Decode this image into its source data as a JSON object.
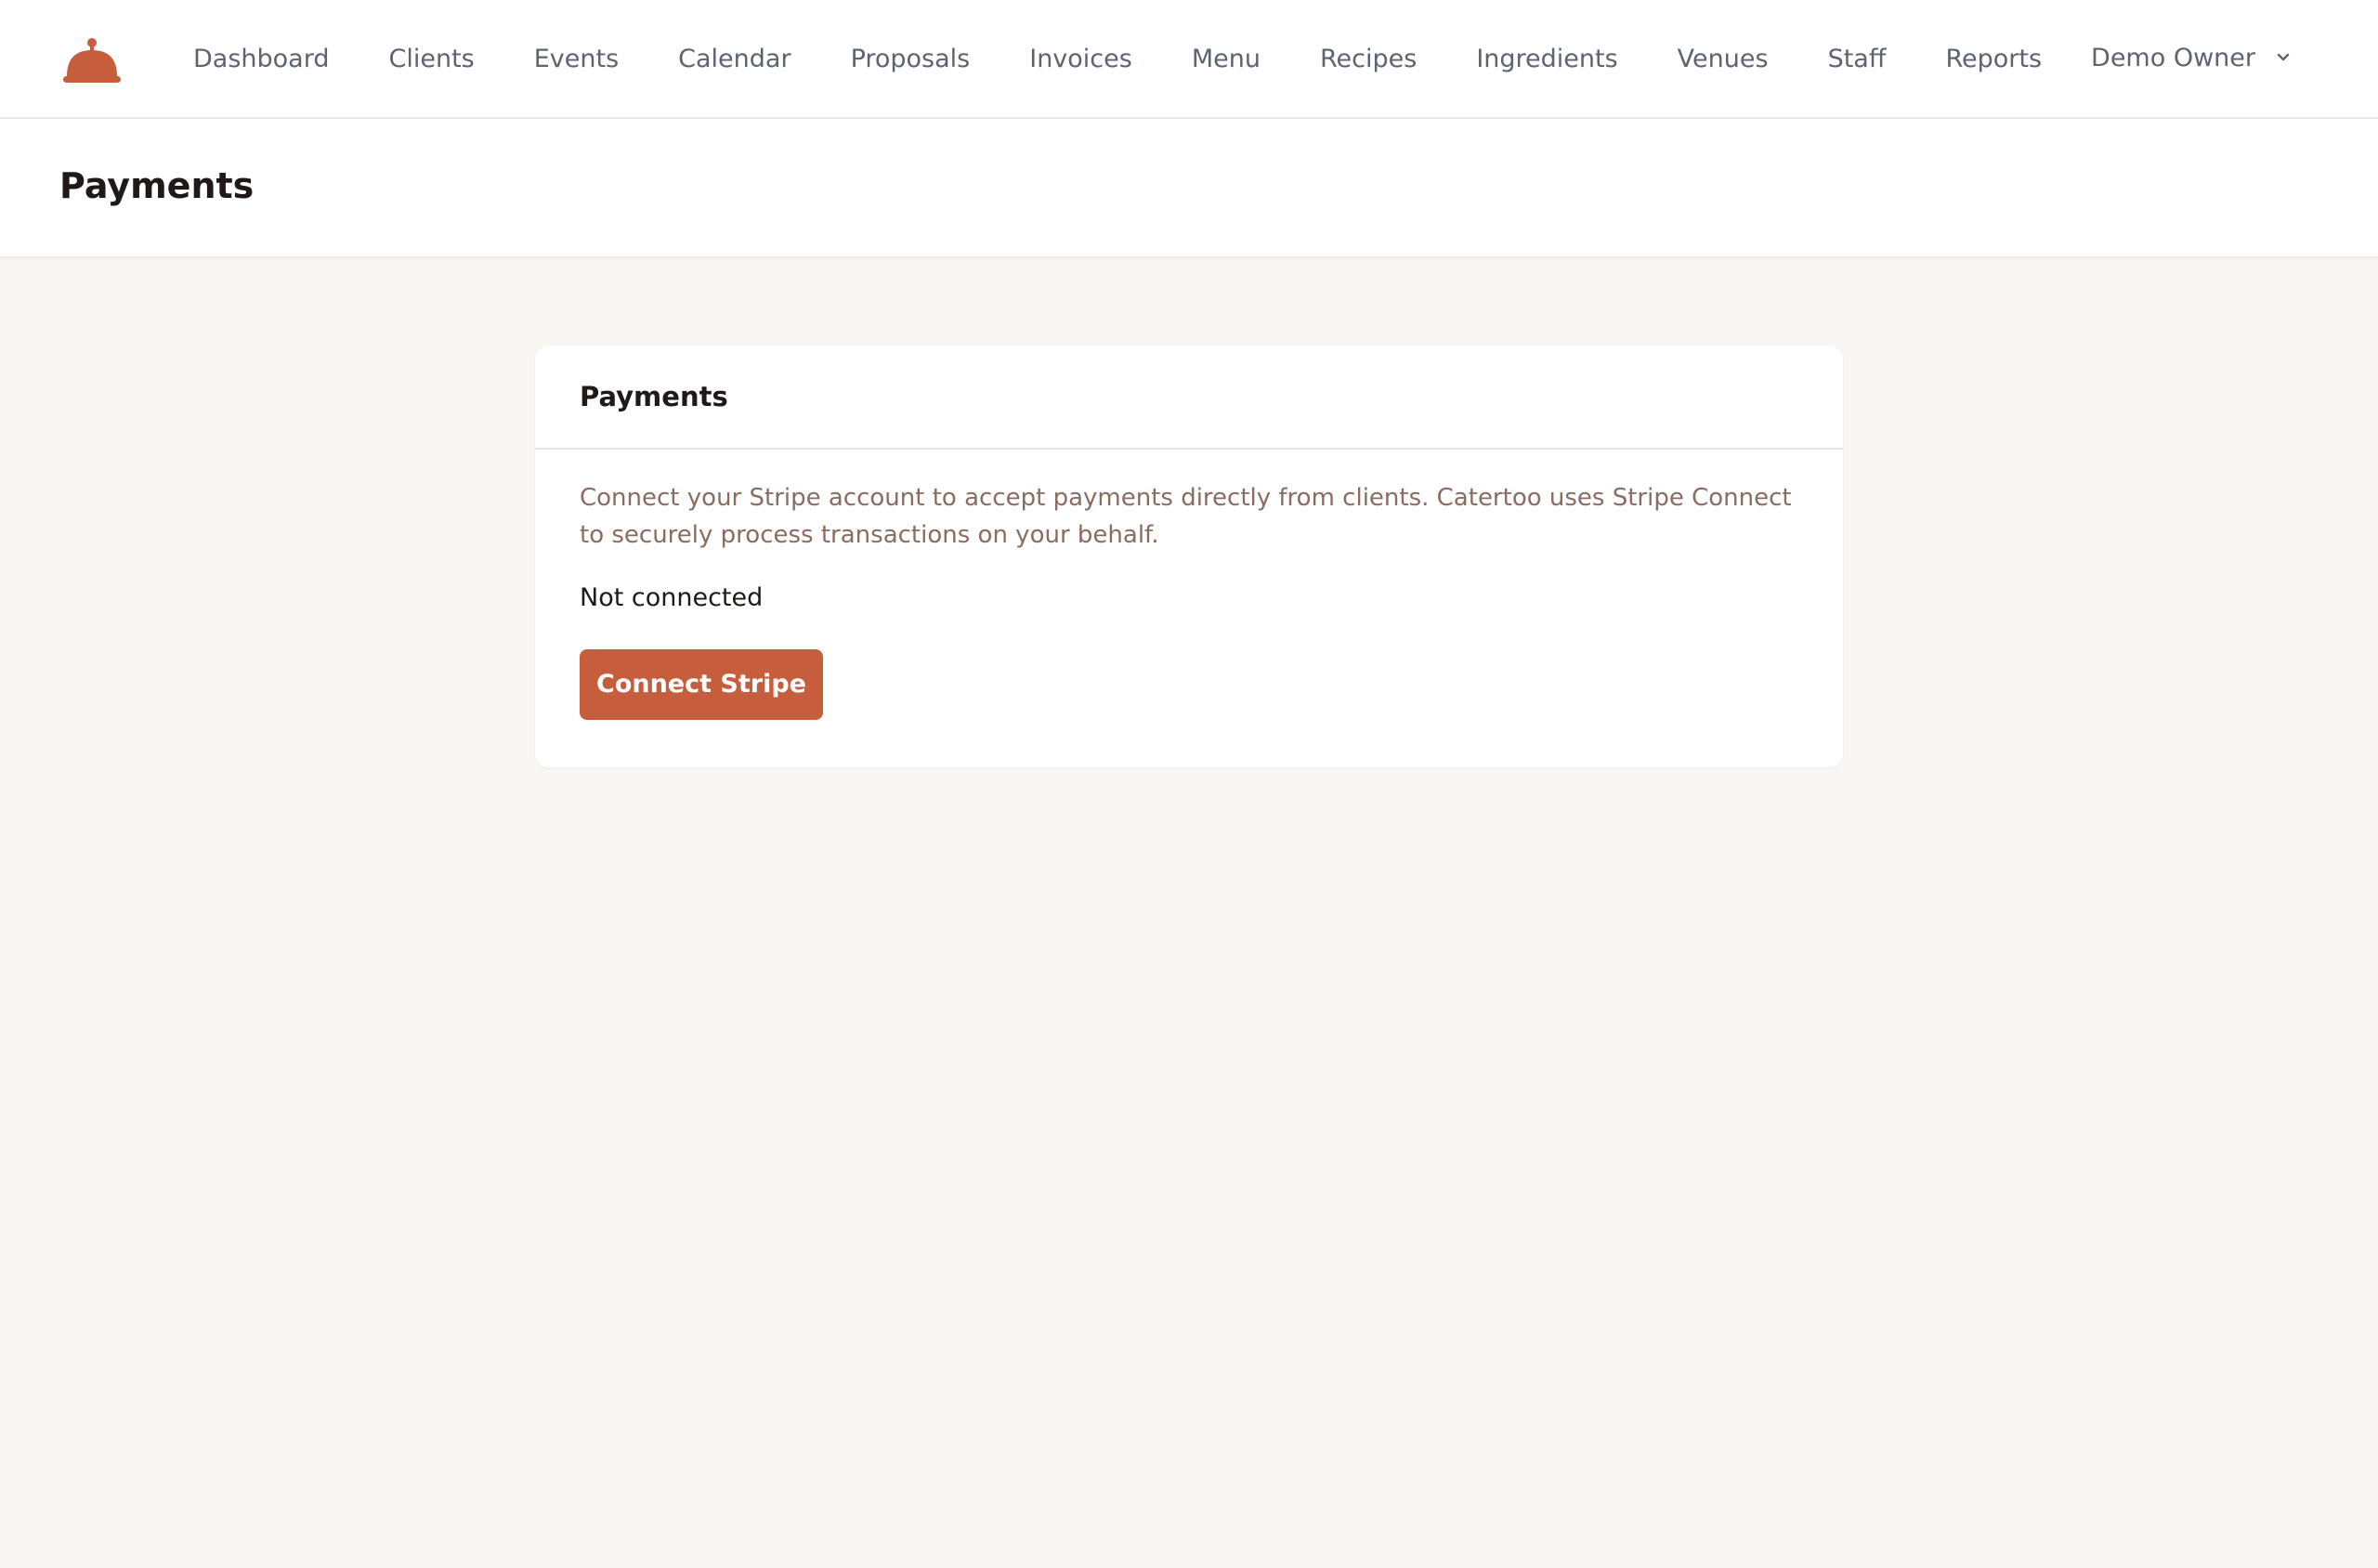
{
  "nav": {
    "logo_icon": "cloche-icon",
    "items": [
      {
        "label": "Dashboard"
      },
      {
        "label": "Clients"
      },
      {
        "label": "Events"
      },
      {
        "label": "Calendar"
      },
      {
        "label": "Proposals"
      },
      {
        "label": "Invoices"
      },
      {
        "label": "Menu"
      },
      {
        "label": "Recipes"
      },
      {
        "label": "Ingredients"
      },
      {
        "label": "Venues"
      },
      {
        "label": "Staff"
      },
      {
        "label": "Reports"
      }
    ],
    "user": {
      "name": "Demo Owner",
      "icon": "chevron-down-icon"
    }
  },
  "page": {
    "title": "Payments"
  },
  "card": {
    "title": "Payments",
    "description": "Connect your Stripe account to accept payments directly from clients. Catertoo uses Stripe Connect to securely process transactions on your behalf.",
    "status": "Not connected",
    "button_label": "Connect Stripe"
  },
  "colors": {
    "accent": "#c65e3d",
    "background": "#f9f6f3",
    "nav_text": "#5c6470",
    "description_text": "#8a6c60"
  }
}
